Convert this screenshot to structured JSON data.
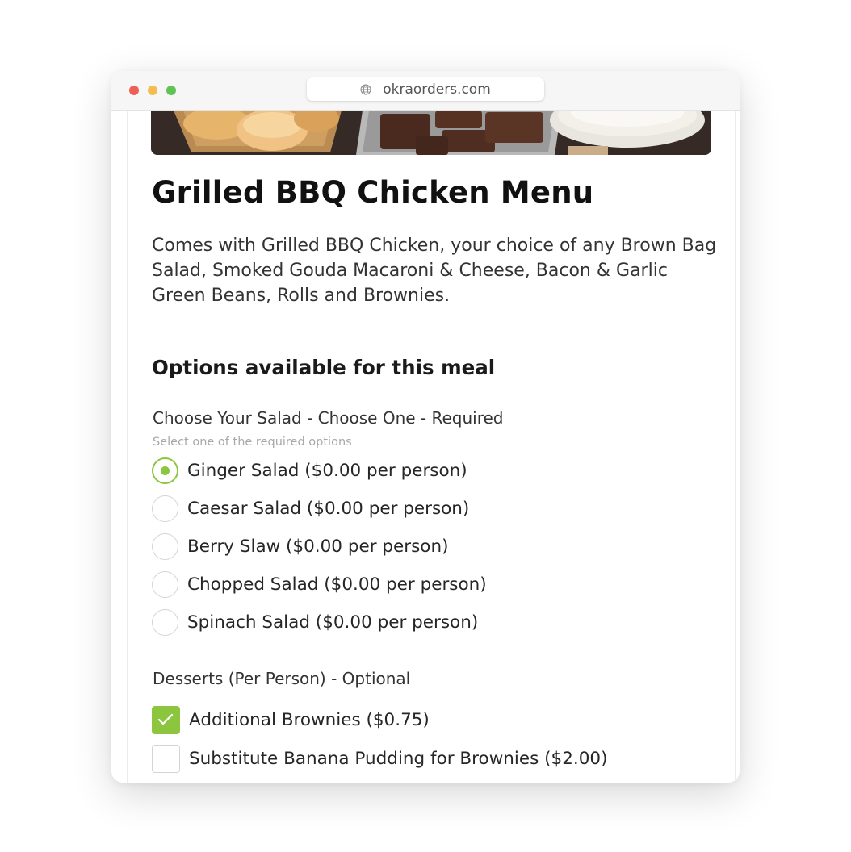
{
  "browser": {
    "url": "okraorders.com"
  },
  "menu": {
    "title": "Grilled BBQ Chicken Menu",
    "description": "Comes with Grilled BBQ Chicken, your choice of any Brown Bag Salad, Smoked Gouda Macaroni & Cheese, Bacon & Garlic Green Beans, Rolls and Brownies."
  },
  "options_heading": "Options available for this meal",
  "salad_group": {
    "label": "Choose Your Salad - Choose One - Required",
    "hint": "Select one of the required options",
    "options": [
      {
        "label": "Ginger Salad ($0.00 per person)",
        "selected": true
      },
      {
        "label": "Caesar Salad ($0.00 per person)",
        "selected": false
      },
      {
        "label": "Berry Slaw ($0.00 per person)",
        "selected": false
      },
      {
        "label": "Chopped Salad ($0.00 per person)",
        "selected": false
      },
      {
        "label": "Spinach Salad ($0.00 per person)",
        "selected": false
      }
    ]
  },
  "dessert_group": {
    "label": "Desserts (Per Person) - Optional",
    "options": [
      {
        "label": "Additional Brownies ($0.75)",
        "checked": true
      },
      {
        "label": "Substitute Banana Pudding for Brownies ($2.00)",
        "checked": false
      }
    ]
  },
  "colors": {
    "accent": "#8cc63f",
    "window_close": "#ee5f57",
    "window_minimize": "#f4bd4f",
    "window_zoom": "#5fc454"
  }
}
